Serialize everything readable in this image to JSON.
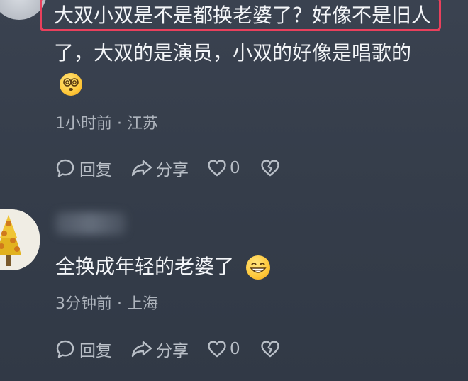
{
  "comment1": {
    "text_line1": "大双小双是不是都换老婆了？好像不是旧人",
    "text_line2": "了，大双的是演员，小双的好像是唱歌的",
    "emoji": "dizzy-eyes-emoji",
    "time": "1小时前",
    "location": "江苏",
    "reply_label": "回复",
    "share_label": "分享",
    "like_count": "0"
  },
  "comment2": {
    "text": "全换成年轻的老婆了",
    "emoji": "grinning-emoji",
    "time": "3分钟前",
    "location": "上海",
    "reply_label": "回复",
    "share_label": "分享",
    "like_count": "0"
  },
  "colors": {
    "background": "#363e4b",
    "highlight_border": "#e9405c",
    "meta_text": "#aeb4bd"
  }
}
